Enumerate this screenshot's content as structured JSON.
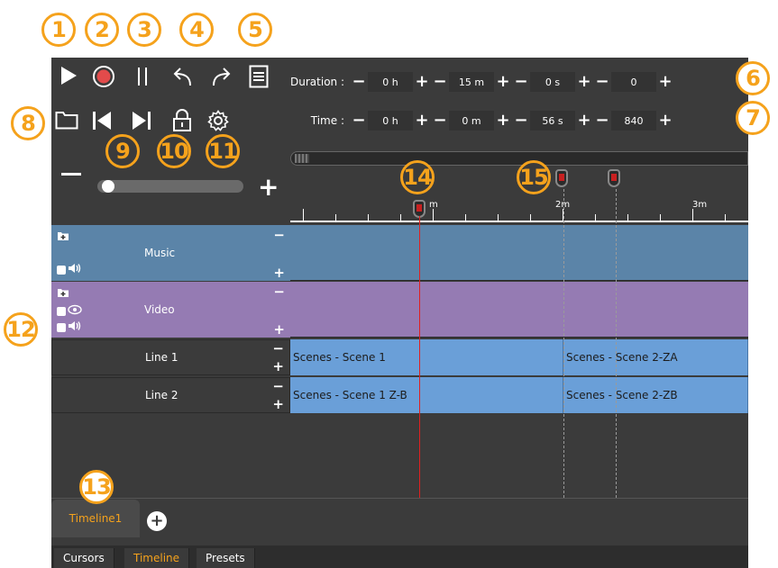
{
  "callouts": [
    "1",
    "2",
    "3",
    "4",
    "5",
    "6",
    "7",
    "8",
    "9",
    "10",
    "11",
    "12",
    "13",
    "14",
    "15"
  ],
  "toolbar": {
    "icons": [
      "play-icon",
      "record-icon",
      "pause-icon",
      "undo-icon",
      "redo-icon",
      "list-icon",
      "folder-icon",
      "go-start-icon",
      "go-end-icon",
      "lock-icon",
      "settings-icon"
    ]
  },
  "duration": {
    "label": "Duration :",
    "h": "0 h",
    "m": "15 m",
    "s": "0 s",
    "ms": "0"
  },
  "time": {
    "label": "Time :",
    "h": "0 h",
    "m": "0 m",
    "s": "56 s",
    "ms": "840"
  },
  "controls": {
    "minus": "−",
    "plus": "+"
  },
  "zoom": {
    "level": 0.02
  },
  "ruler": {
    "labels": [
      "m",
      "2m",
      "3m"
    ]
  },
  "tracks": [
    {
      "name": "Music",
      "color": "#5b84a8"
    },
    {
      "name": "Video",
      "color": "#957bb3"
    },
    {
      "name": "Line 1",
      "color": "#3b3b3b"
    },
    {
      "name": "Line 2",
      "color": "#3b3b3b"
    }
  ],
  "clips": {
    "line1": [
      "Scenes - Scene 1",
      "Scenes - Scene 2-ZA"
    ],
    "line2": [
      "Scenes - Scene 1 Z-B",
      "Scenes - Scene 2-ZB"
    ]
  },
  "tabs": {
    "timeline": "Timeline1",
    "add": "+"
  },
  "bottom_tabs": [
    "Cursors",
    "Timeline",
    "Presets"
  ],
  "colors": {
    "accent": "#f5a21c",
    "cursor": "#e02020",
    "clip": "#6a9fd8"
  }
}
